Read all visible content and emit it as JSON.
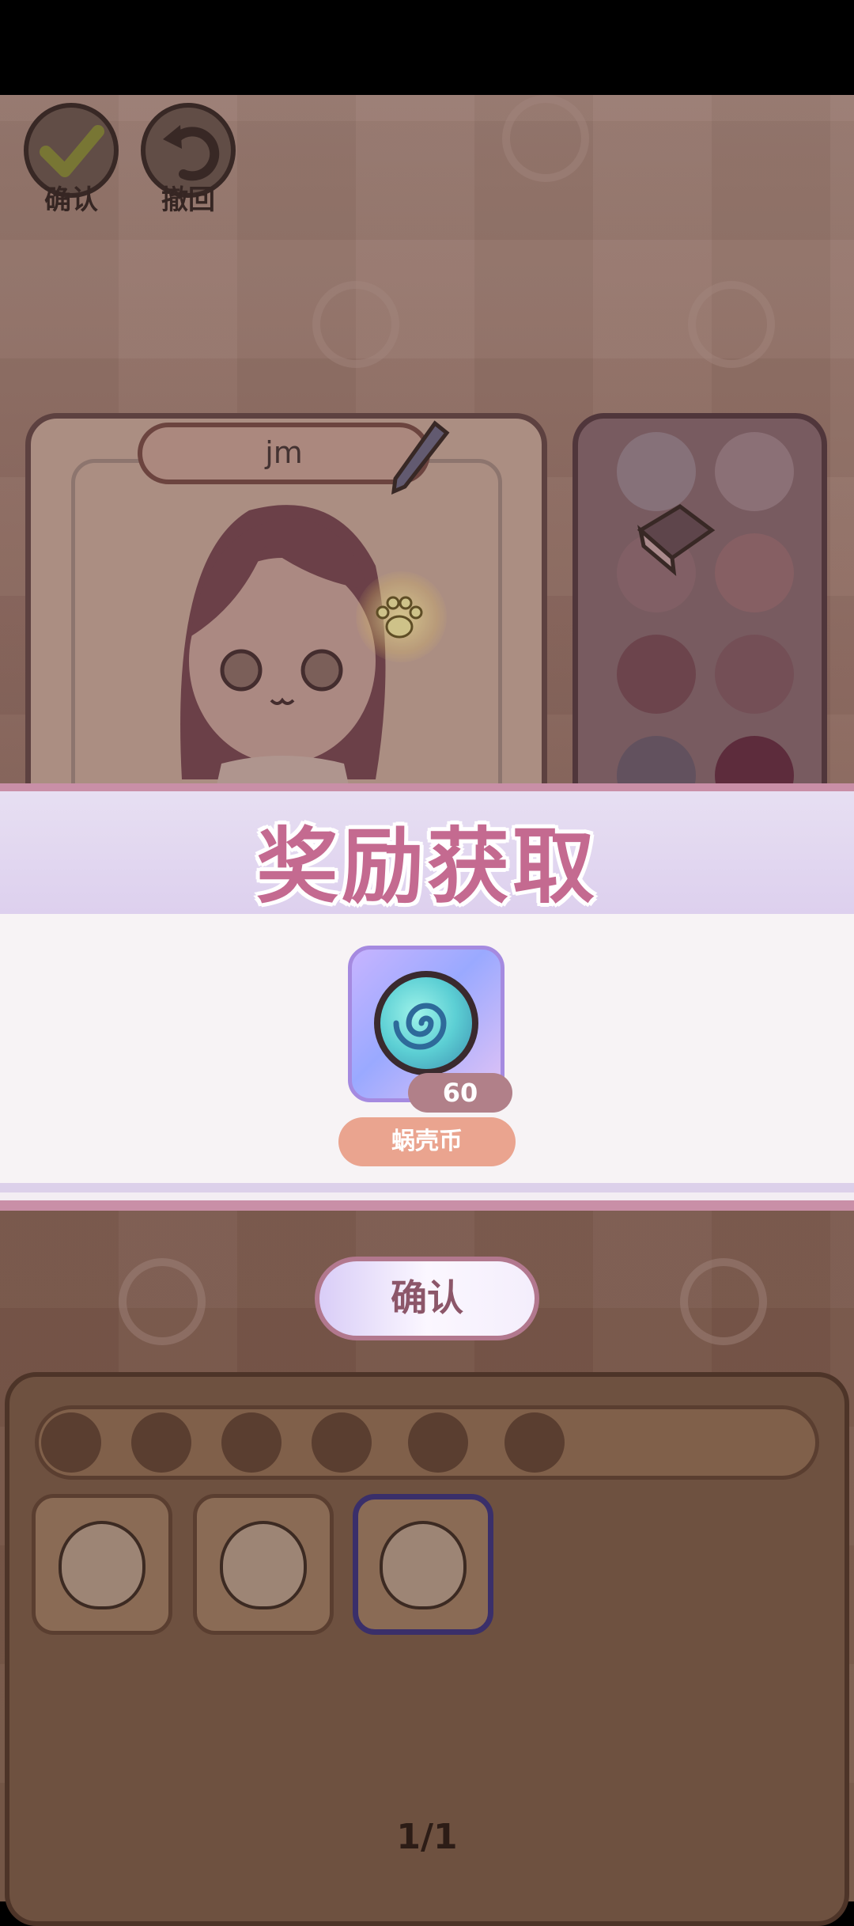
{
  "toolbar": {
    "confirm_label": "确认",
    "undo_label": "撤回"
  },
  "character": {
    "name": "jm"
  },
  "reward": {
    "title": "奖励获取",
    "item_name": "蜗壳币",
    "quantity": "60",
    "button_label": "确认"
  },
  "wardrobe": {
    "pager": "1/1"
  },
  "colors": {
    "title": "#c46a90",
    "quantity_badge": "#b18089",
    "item_name_badge": "#eaa48f",
    "button_border": "#b2788e"
  },
  "icons": [
    "check-icon",
    "undo-icon",
    "pencil-icon",
    "paw-icon",
    "eraser-icon",
    "coin-swirl-icon"
  ]
}
